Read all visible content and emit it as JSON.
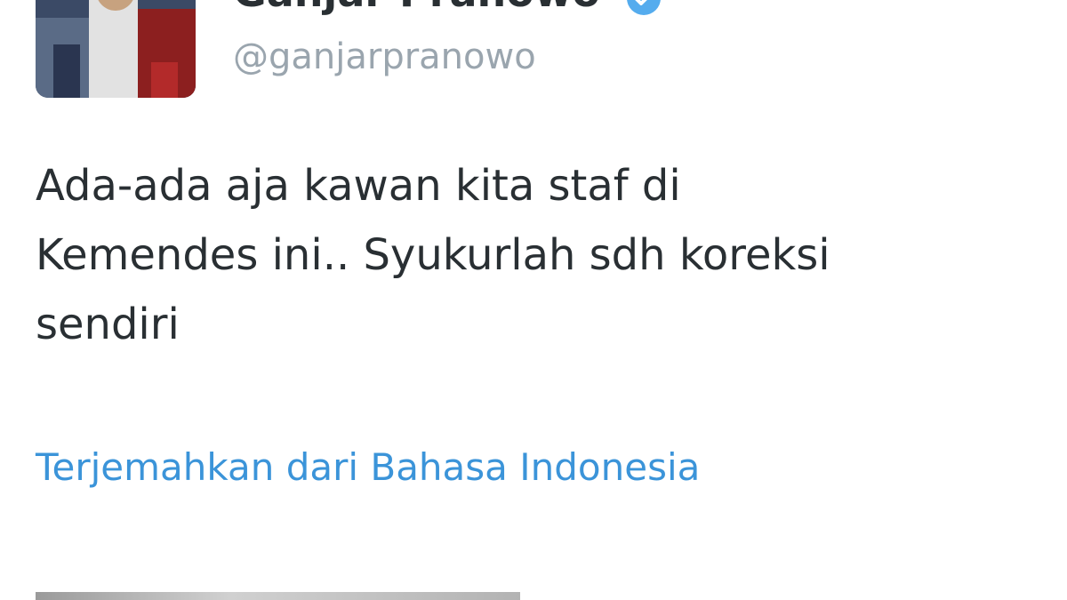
{
  "tweet": {
    "display_name": "Ganjar Pranowo",
    "handle": "@ganjarpranowo",
    "verified_icon": "verified-badge-icon",
    "text_lines": [
      "Ada-ada aja kawan kita staf di",
      "Kemendes ini.. Syukurlah sdh koreksi",
      "sendiri"
    ],
    "translate_link": "Terjemahkan dari Bahasa Indonesia",
    "avatar_icon": "profile-photo"
  },
  "colors": {
    "text": "#292f33",
    "handle": "#9aa5ae",
    "link": "#3b94d9",
    "verified": "#55acee"
  }
}
